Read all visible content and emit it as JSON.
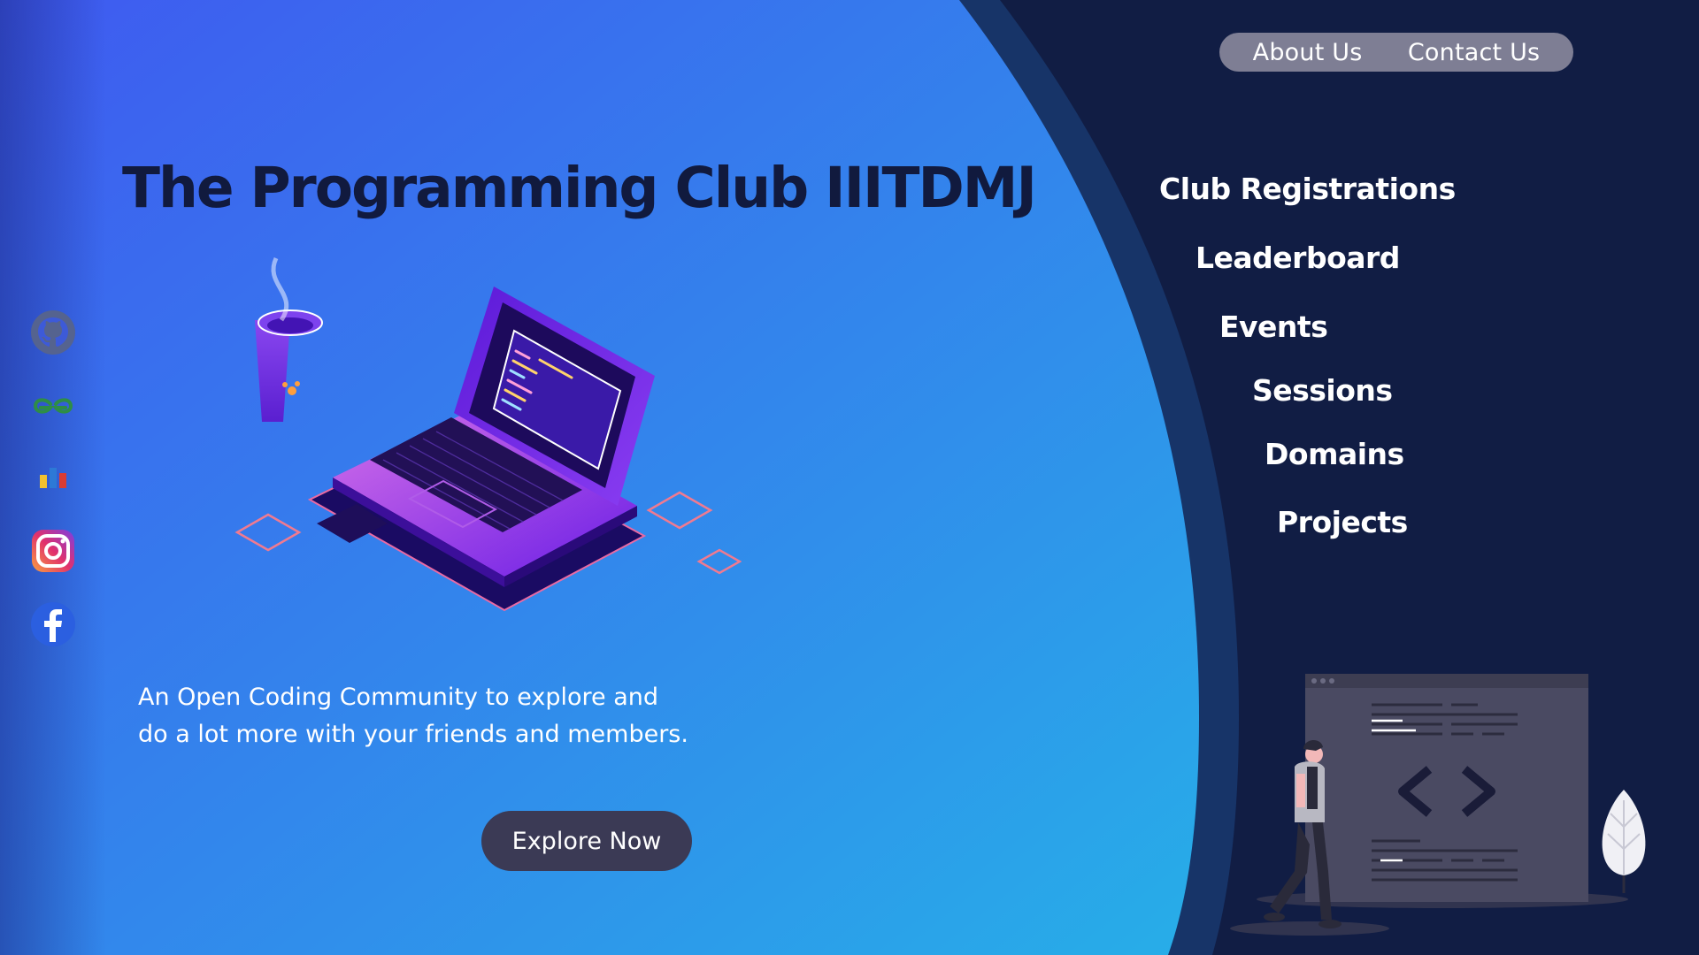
{
  "header": {
    "nav": [
      {
        "label": "About Us"
      },
      {
        "label": "Contact Us"
      }
    ]
  },
  "hero": {
    "title": "The Programming Club IIITDMJ",
    "tagline_line1": "An Open Coding Community to explore and",
    "tagline_line2": "do a lot more with your friends and members.",
    "cta_label": "Explore Now"
  },
  "menu": {
    "items": [
      {
        "label": "Club Registrations"
      },
      {
        "label": "Leaderboard"
      },
      {
        "label": "Events"
      },
      {
        "label": "Sessions"
      },
      {
        "label": "Domains"
      },
      {
        "label": "Projects"
      }
    ]
  },
  "social": {
    "icons": [
      "github-icon",
      "geeksforgeeks-icon",
      "codechef-icon",
      "instagram-icon",
      "facebook-icon"
    ]
  },
  "colors": {
    "gradient_start": "#3f5af0",
    "gradient_end": "#27aee8",
    "dark_bg": "#111d44",
    "title": "#111a3e",
    "button": "#3b3a55",
    "nav_pill": "#7e7e94"
  }
}
